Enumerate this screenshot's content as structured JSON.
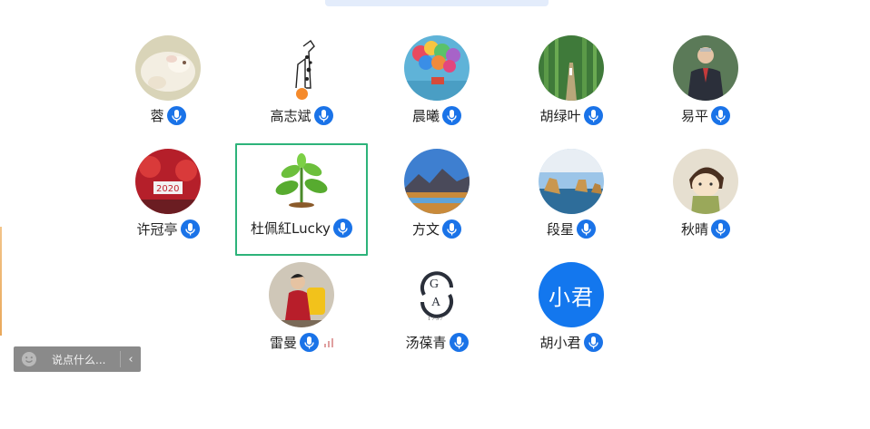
{
  "colors": {
    "mic": "#1a73e8",
    "selected_border": "#2db37a",
    "text_avatar": "#1377ee",
    "chat_bg": "#8a8a8a"
  },
  "participants": [
    {
      "name": "蓉",
      "avatar": "photo-hamster",
      "mic": "mic-icon"
    },
    {
      "name": "高志斌",
      "avatar": "sketch-giraffe",
      "mic": "mic-icon",
      "host_badge": "person-icon"
    },
    {
      "name": "晨曦",
      "avatar": "photo-balloons",
      "mic": "mic-icon"
    },
    {
      "name": "胡绿叶",
      "avatar": "photo-forest-path",
      "mic": "mic-icon"
    },
    {
      "name": "易平",
      "avatar": "photo-man-suit",
      "mic": "mic-icon"
    },
    {
      "name": "许冠亭",
      "avatar": "photo-red-decor",
      "mic": "mic-icon"
    },
    {
      "name": "杜佩紅Lucky",
      "avatar": "sprout-icon",
      "mic": "mic-icon",
      "selected": true
    },
    {
      "name": "方文",
      "avatar": "photo-mountains",
      "mic": "mic-icon"
    },
    {
      "name": "段星",
      "avatar": "photo-coast",
      "mic": "mic-icon"
    },
    {
      "name": "秋晴",
      "avatar": "cartoon-girl",
      "mic": "mic-icon"
    },
    {
      "name": "雷曼",
      "avatar": "photo-woman-yellow-chair",
      "mic": "mic-icon",
      "signal": "volume-bars-icon"
    },
    {
      "name": "汤葆青",
      "avatar": "logo-monogram",
      "mic": "mic-icon"
    },
    {
      "name": "胡小君",
      "avatar_text": "小君",
      "mic": "mic-icon"
    }
  ],
  "chat": {
    "placeholder": "说点什么...",
    "emoji_icon": "smile-icon",
    "collapse_icon": "chevron-left-icon"
  }
}
